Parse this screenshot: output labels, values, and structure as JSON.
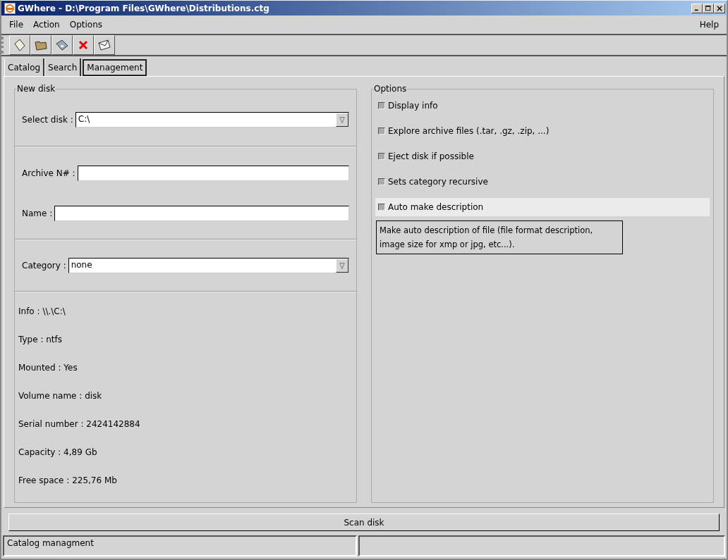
{
  "window": {
    "title": "GWhere - D:\\Program Files\\GWhere\\Distributions.ctg"
  },
  "menu": [
    {
      "label": "File"
    },
    {
      "label": "Action"
    },
    {
      "label": "Options"
    }
  ],
  "help_menu": {
    "label": "Help"
  },
  "toolbar": [
    {
      "kind": "new"
    },
    {
      "kind": "open"
    },
    {
      "kind": "save"
    },
    {
      "kind": "delete"
    },
    {
      "kind": "mail"
    }
  ],
  "tabs": [
    {
      "label": "Catalog",
      "selected": false
    },
    {
      "label": "Search",
      "selected": false
    },
    {
      "label": "Management",
      "selected": true
    }
  ],
  "new_disk": {
    "title": "New disk",
    "select_disk": {
      "label": "Select disk :",
      "value": "C:\\"
    },
    "archive_number": {
      "label": "Archive N# :"
    },
    "name": {
      "label": "Name :"
    },
    "category": {
      "label": "Category :",
      "value": "none"
    },
    "info": [
      "Info : \\\\.\\C:\\",
      "Type : ntfs",
      "Mounted : Yes",
      "Volume name : disk",
      "Serial number : 2424142884",
      "Capacity : 4,89 Gb",
      "Free space : 225,76 Mb"
    ]
  },
  "options": {
    "title": "Options",
    "items": [
      {
        "label": "Display info",
        "checked": false,
        "highlighted": false
      },
      {
        "label": "Explore archive files (.tar, .gz, .zip, ...)",
        "checked": false,
        "highlighted": false
      },
      {
        "label": "Eject disk if possible",
        "checked": false,
        "highlighted": false
      },
      {
        "label": "Sets category recursive",
        "checked": false,
        "highlighted": false
      },
      {
        "label": "Auto make description",
        "checked": false,
        "highlighted": true
      }
    ],
    "tooltip": "Make auto description of file (file format description, image size for xmp or jpg, etc...)."
  },
  "scan_button": "Scan disk",
  "status_bar": [
    "Catalog managment"
  ]
}
